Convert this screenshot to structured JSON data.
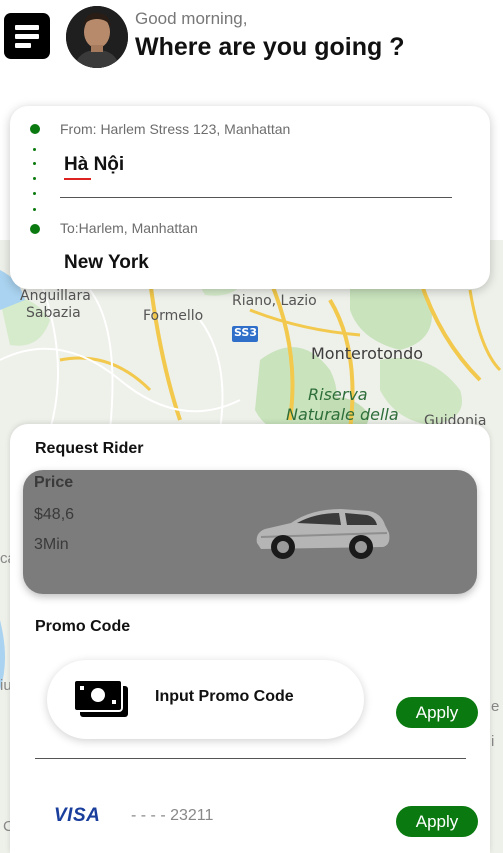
{
  "header": {
    "greeting": "Good morning,",
    "title": "Where are you going ?"
  },
  "route": {
    "from_label": "From: Harlem Stress 123, Manhattan",
    "from_value": "Hà Nội",
    "to_label": "To:Harlem, Manhattan",
    "to_value": "New York"
  },
  "map": {
    "labels": [
      "Anguillara",
      "Sabazia",
      "Formello",
      "Riano, Lazio",
      "SS3",
      "Monterotondo",
      "Riserva",
      "Naturale della",
      "Guidonia"
    ],
    "edge_labels": [
      "ca",
      "iu",
      "e",
      "i",
      "C"
    ]
  },
  "request": {
    "title": "Request Rider",
    "price_label": "Price",
    "price_value": "$48,6",
    "time_value": "3Min"
  },
  "promo": {
    "title": "Promo Code",
    "input_label": "Input Promo Code",
    "apply_label": "Apply"
  },
  "payment": {
    "brand": "VISA",
    "card_number": "- - - - 23211",
    "apply_label": "Apply"
  },
  "colors": {
    "accent_green": "#0a7a10",
    "visa_blue": "#1a3e9c",
    "ride_card_gray": "#7c7c7c"
  },
  "icons": [
    "menu-icon",
    "avatar",
    "route-dot-icon",
    "car-image",
    "cash-icon",
    "visa-logo"
  ]
}
